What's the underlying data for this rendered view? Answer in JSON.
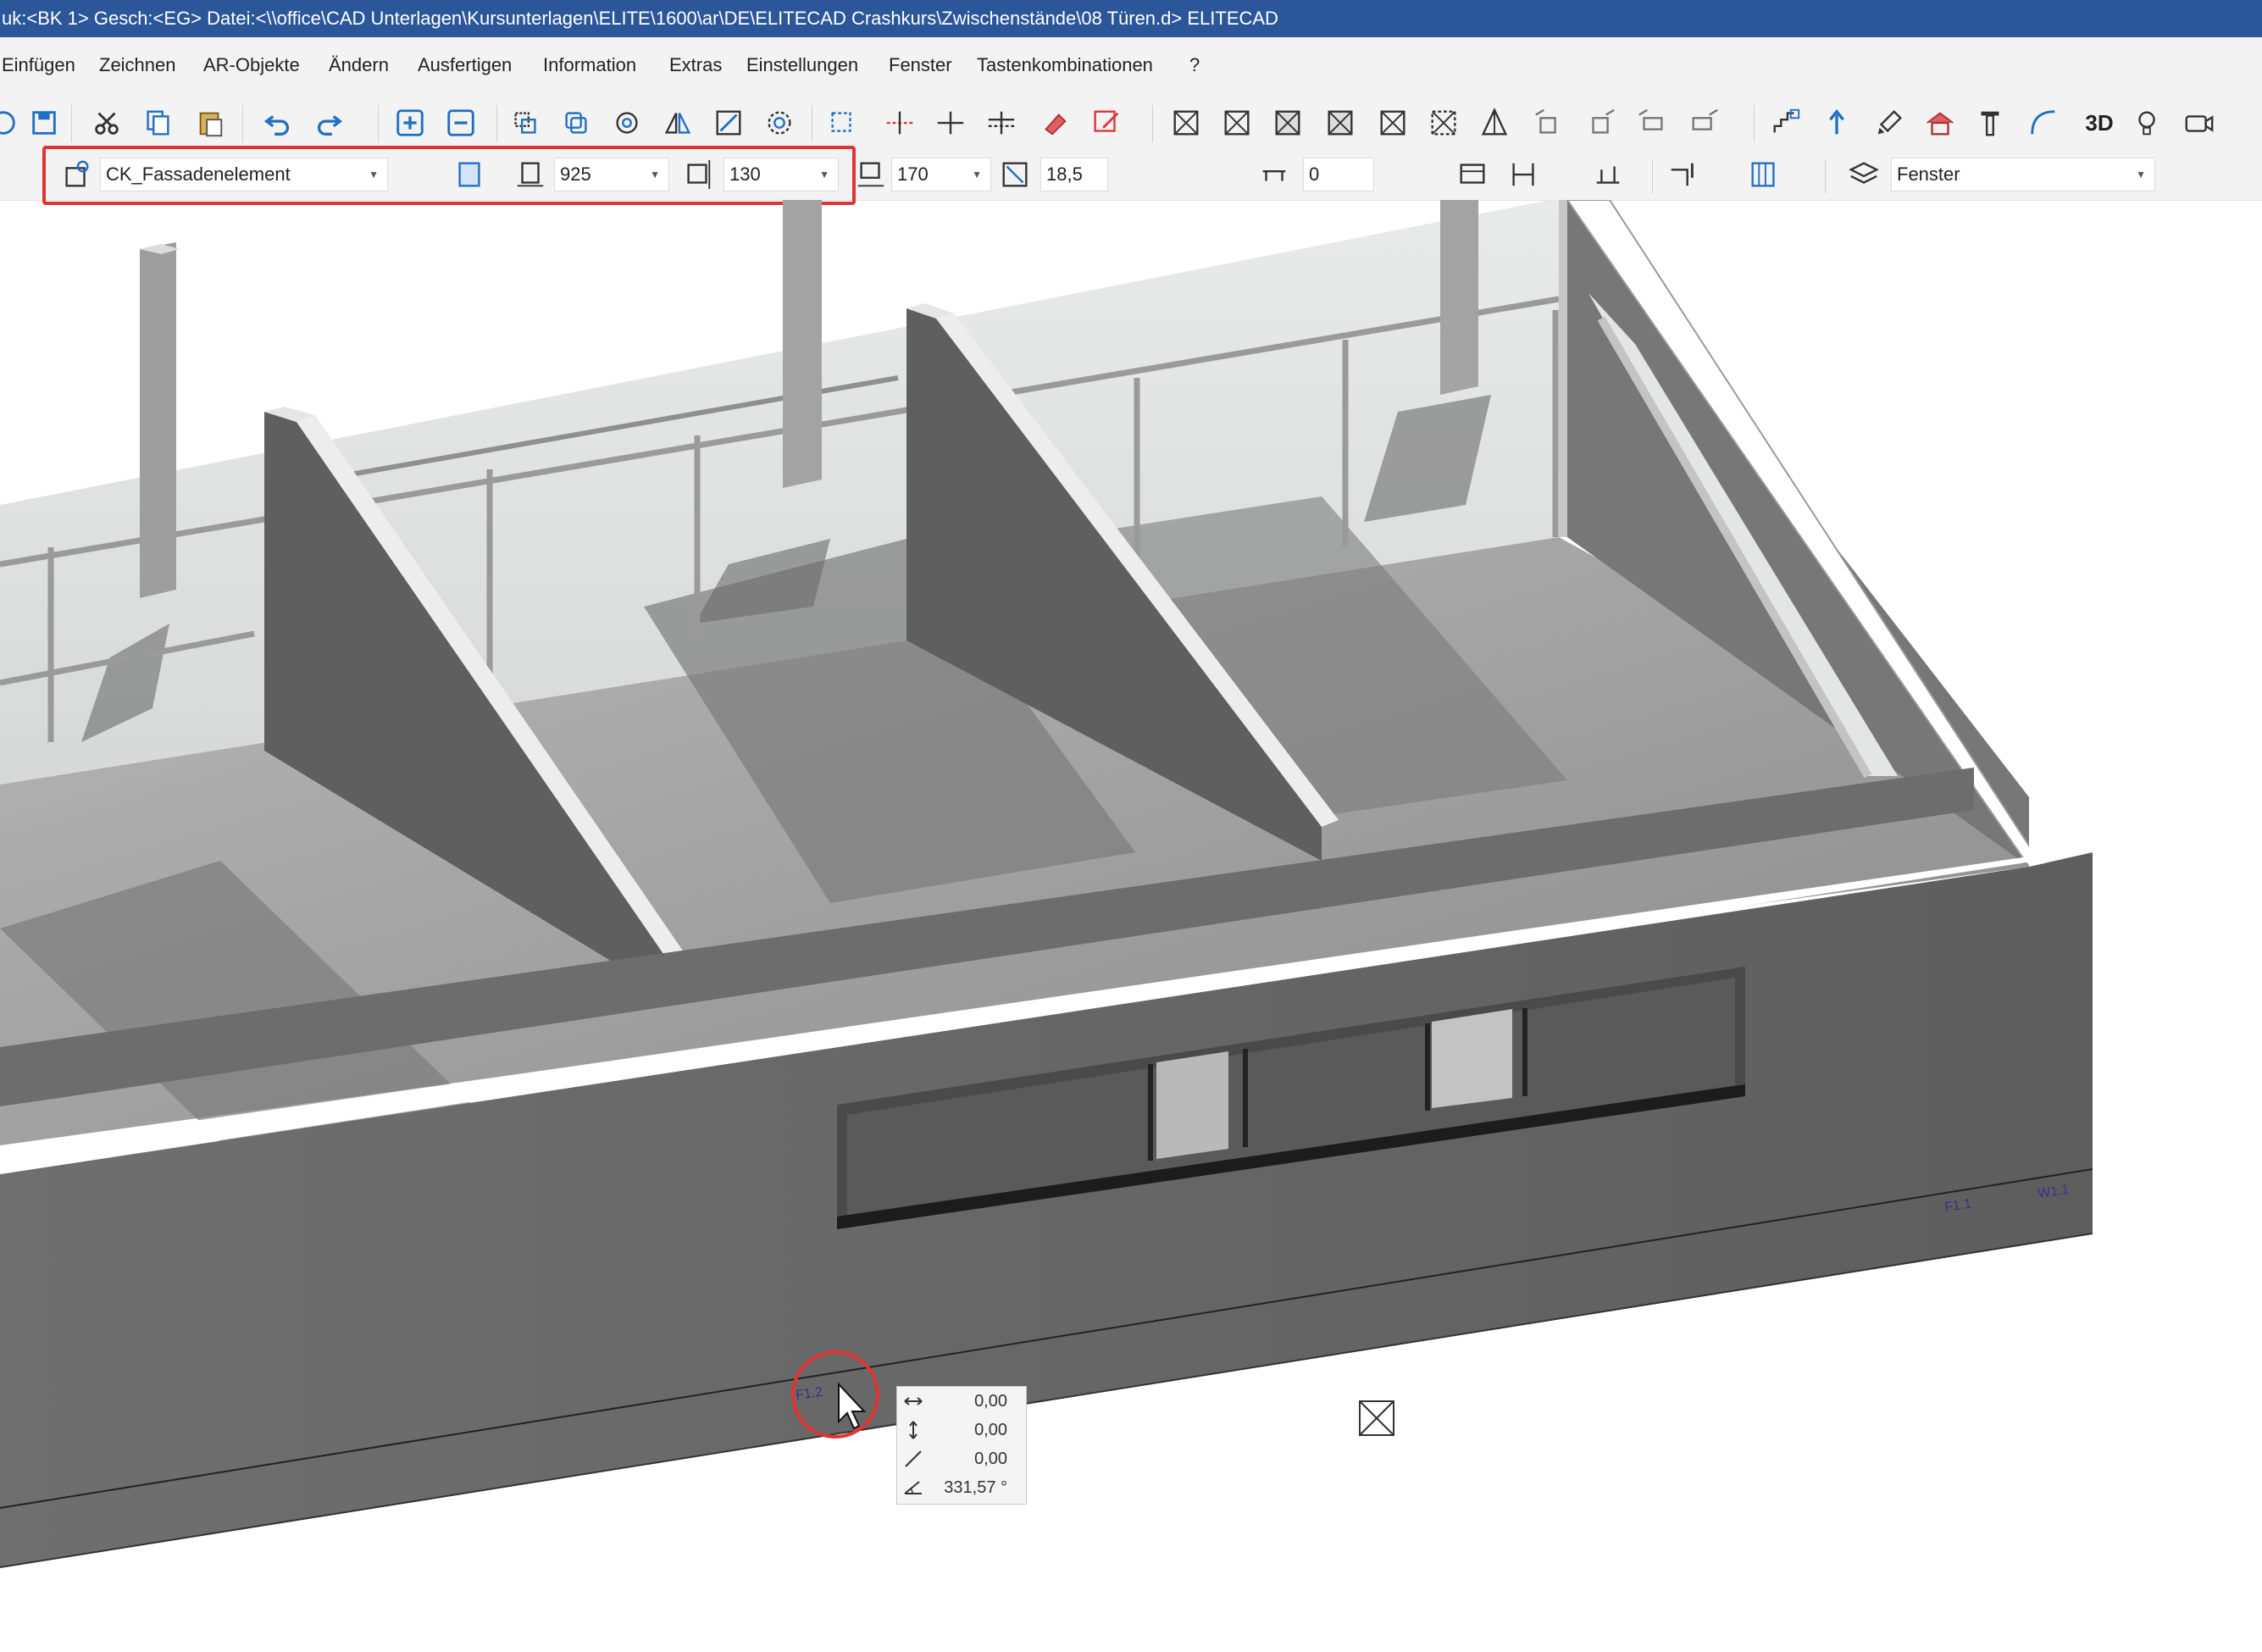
{
  "titlebar": {
    "text": "uk:<BK 1>  Gesch:<EG>  Datei:<\\\\office\\CAD Unterlagen\\Kursunterlagen\\ELITE\\1600\\ar\\DE\\ELITECAD Crashkurs\\Zwischenstände\\08 Türen.d> ELITECAD"
  },
  "menu": [
    "Einfügen",
    "Zeichnen",
    "AR-Objekte",
    "Ändern",
    "Ausfertigen",
    "Information",
    "Extras",
    "Einstellungen",
    "Fenster",
    "Tastenkombinationen",
    "?"
  ],
  "properties": {
    "type_value": "CK_Fassadenelement",
    "width_value": "925",
    "height_value": "130",
    "sill_value": "170",
    "angle_value": "18,5",
    "offset_value": "0",
    "layer_value": "Fenster"
  },
  "toolbar3d_label": "3D",
  "scene_labels": {
    "wall_tag_1": "F1.2",
    "wall_tag_2": "F1.1",
    "wall_tag_3": "W1.1"
  },
  "coords": {
    "dx": "0,00",
    "dy": "0,00",
    "dz": "0,00",
    "angle": "331,57 °"
  },
  "colors": {
    "title_bg": "#2b579a",
    "accent_red": "#e03434",
    "toolbar_blue": "#1f6fc5"
  }
}
